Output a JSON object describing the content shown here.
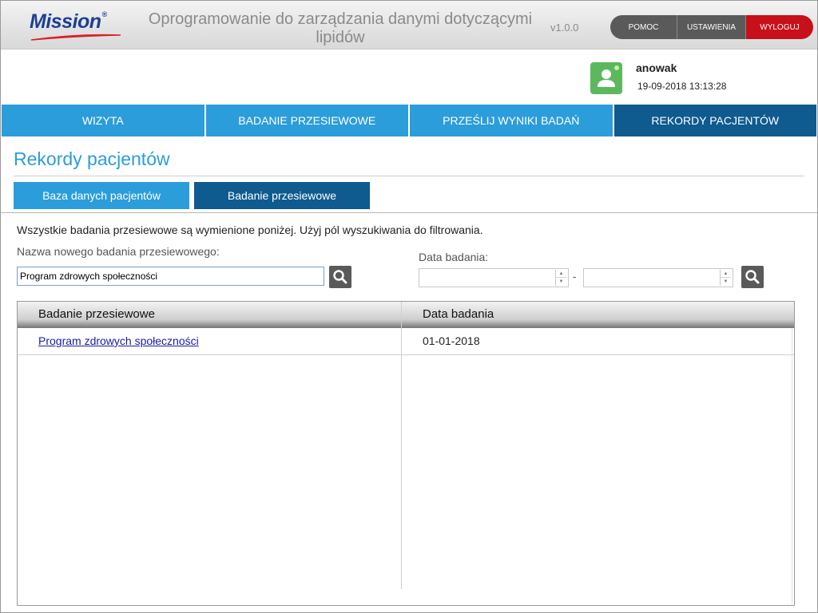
{
  "header": {
    "logo_text": "Mission",
    "logo_reg": "®",
    "title": "Oprogramowanie do zarządzania danymi dotyczącymi lipidów",
    "version": "v1.0.0",
    "buttons": {
      "help": "POMOC",
      "settings": "USTAWIENIA",
      "logout": "WYLOGUJ"
    },
    "colors": {
      "logout": "#c8101a",
      "button": "#5a5a5a",
      "logo": "#1c3f95"
    }
  },
  "user": {
    "name": "anowak",
    "datetime": "19-09-2018 13:13:28",
    "avatar_icon": "user-icon",
    "avatar_color": "#5cb85c"
  },
  "nav": {
    "tabs": [
      {
        "label": "WIZYTA",
        "active": false
      },
      {
        "label": "BADANIE PRZESIEWOWE",
        "active": false
      },
      {
        "label": "PRZEŚLIJ WYNIKI BADAŃ",
        "active": false
      },
      {
        "label": "REKORDY PACJENTÓW",
        "active": true
      }
    ],
    "colors": {
      "tab": "#2c9ddb",
      "active": "#0f5a8f"
    }
  },
  "page": {
    "title": "Rekordy pacjentów",
    "subtabs": [
      {
        "label": "Baza danych pacjentów",
        "active": false
      },
      {
        "label": "Badanie przesiewowe",
        "active": true
      }
    ],
    "info": "Wszystkie badania przesiewowe są wymienione poniżej. Użyj pól wyszukiwania do filtrowania."
  },
  "search": {
    "name_label": "Nazwa nowego badania przesiewowego:",
    "name_value": "Program zdrowych społeczności",
    "date_label": "Data badania:",
    "date_from": "",
    "date_to": "",
    "range_separator": "-",
    "search_icon": "magnifier-icon"
  },
  "table": {
    "headers": [
      "Badanie przesiewowe",
      "Data badania"
    ],
    "rows": [
      {
        "name": "Program zdrowych społeczności",
        "date": "01-01-2018"
      }
    ]
  }
}
